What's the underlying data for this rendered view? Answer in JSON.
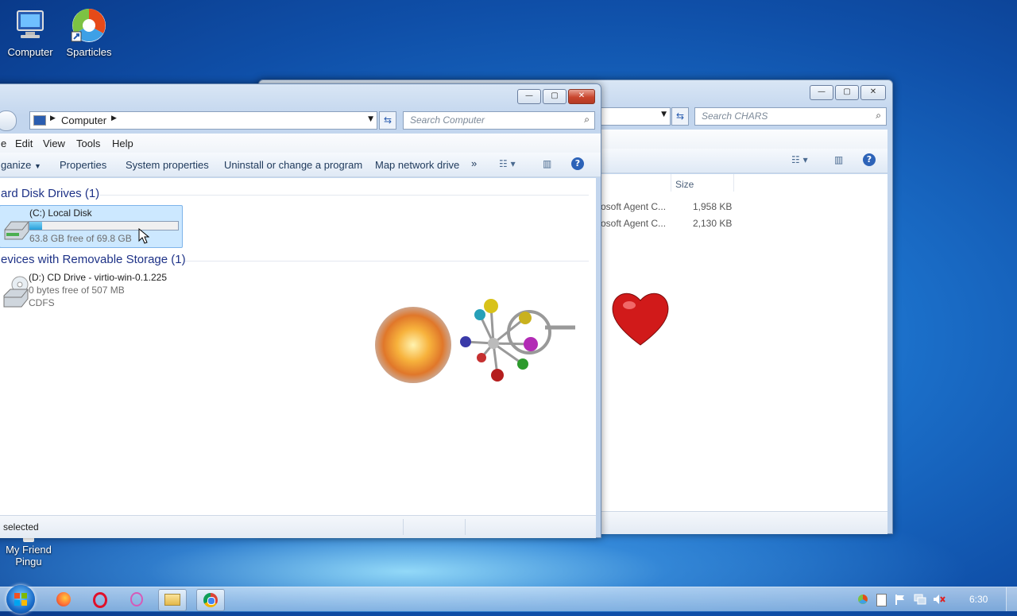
{
  "desktop": {
    "icons": [
      {
        "label": "Computer",
        "icon": "computer-icon"
      },
      {
        "label": "Sparticles",
        "icon": "sparticles-icon"
      },
      {
        "label": "My Friend Pingu",
        "icon": "pingu-icon"
      }
    ]
  },
  "back_window": {
    "search_placeholder": "Search CHARS",
    "column_size": "Size",
    "rows": [
      {
        "name": "osoft Agent C...",
        "size": "1,958 KB"
      },
      {
        "name": "osoft Agent C...",
        "size": "2,130 KB"
      }
    ]
  },
  "front_window": {
    "breadcrumb": "Computer",
    "search_placeholder": "Search Computer",
    "menu": [
      "e",
      "Edit",
      "View",
      "Tools",
      "Help"
    ],
    "commands": {
      "organize": "ganize",
      "properties": "Properties",
      "system_properties": "System properties",
      "uninstall": "Uninstall or change a program",
      "map_drive": "Map network drive",
      "more": "»"
    },
    "groups": {
      "hard_disk": "ard Disk Drives (1)",
      "removable": "evices with Removable Storage (1)"
    },
    "drive_c": {
      "name": "(C:) Local Disk",
      "free": "63.8 GB free of 69.8 GB",
      "used_fraction": 0.086
    },
    "drive_d": {
      "name": "(D:) CD Drive - virtio-win-0.1.225",
      "free": "0 bytes free of 507 MB",
      "fs": "CDFS"
    },
    "status": "selected"
  },
  "taskbar": {
    "clock": "6:30",
    "buttons": [
      "start-orb",
      "firefox",
      "opera",
      "opera-gx",
      "explorer",
      "chrome"
    ]
  },
  "colors": {
    "accent": "#1e3287",
    "disk_bar": "#26a0da",
    "selection": "#cce8ff"
  }
}
